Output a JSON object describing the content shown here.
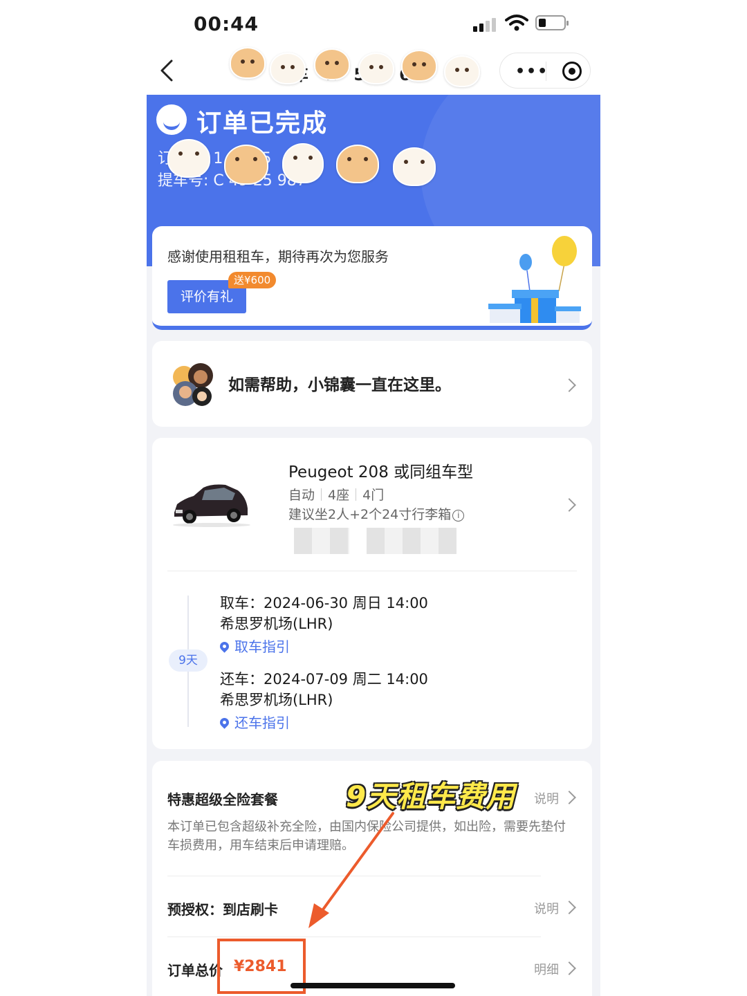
{
  "status_bar": {
    "time": "00:44"
  },
  "nav": {
    "title": "车  1  59  63"
  },
  "hero": {
    "status_title": "订单已完成",
    "order_label": "订单号: 1  594  5",
    "pickup_code_label": "提车号: C  49  25  987"
  },
  "thanks": {
    "message": "感谢使用租租车，期待再次为您服务",
    "review_button": "评价有礼",
    "gift_badge": "送¥600"
  },
  "help": {
    "message": "如需帮助，小锦囊一直在这里。"
  },
  "car": {
    "name": "Peugeot 208 或同组车型",
    "specs": [
      "自动",
      "4座",
      "4门"
    ],
    "luggage": "建议坐2人+2个24寸行李箱",
    "duration": "9天",
    "pickup": {
      "time": "取车：2024-06-30 周日 14:00",
      "location": "希思罗机场(LHR)",
      "guide": "取车指引"
    },
    "return": {
      "time": "还车：2024-07-09 周二 14:00",
      "location": "希思罗机场(LHR)",
      "guide": "还车指引"
    }
  },
  "price": {
    "package_title": "特惠超级全险套餐",
    "package_link": "说明",
    "package_desc": "本订单已包含超级补充全险，由国内保险公司提供，如出险，需要先垫付车损费用，用车结束后申请理赔。",
    "preauth": "预授权：到店刷卡",
    "preauth_link": "说明",
    "total_label": "订单总价",
    "total_value": "¥2841",
    "total_link": "明细"
  },
  "annotation": {
    "text": "9天租车费用",
    "color": "#ec5b2c"
  },
  "colors": {
    "brand_blue": "#4b73ea",
    "price_orange": "#ec5b2c",
    "badge_orange": "#f28a2e"
  }
}
